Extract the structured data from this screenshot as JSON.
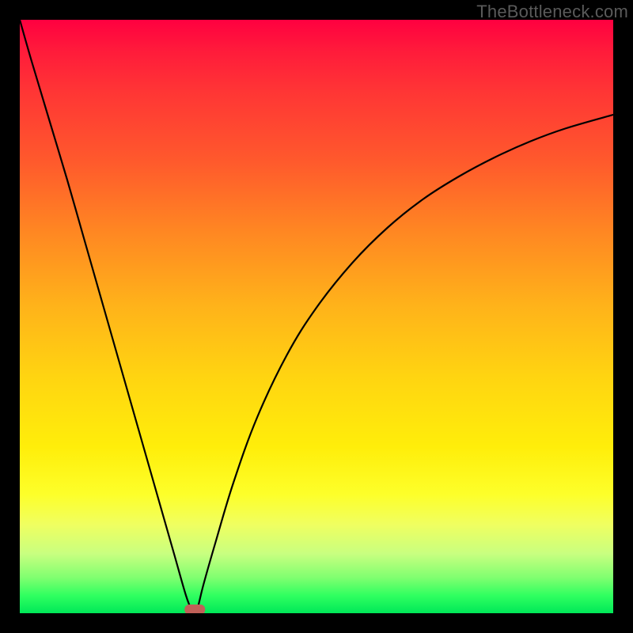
{
  "watermark": "TheBottleneck.com",
  "chart_data": {
    "type": "line",
    "title": "",
    "xlabel": "",
    "ylabel": "",
    "xlim": [
      0,
      100
    ],
    "ylim": [
      0,
      100
    ],
    "grid": false,
    "legend": false,
    "series": [
      {
        "name": "left-branch",
        "x": [
          0,
          2,
          5,
          8,
          11,
          14,
          17,
          20,
          23,
          26,
          28,
          29,
          29.5
        ],
        "y": [
          100,
          93,
          83,
          73,
          62.5,
          52,
          41.5,
          31,
          20.5,
          10,
          3,
          0.5,
          0
        ]
      },
      {
        "name": "right-branch",
        "x": [
          29.5,
          30,
          31,
          33,
          36,
          40,
          45,
          50,
          56,
          62,
          68,
          74,
          80,
          86,
          92,
          100
        ],
        "y": [
          0,
          1,
          5,
          12,
          22,
          33,
          43.5,
          51.5,
          59,
          65,
          69.8,
          73.6,
          76.8,
          79.5,
          81.7,
          84
        ]
      }
    ],
    "marker": {
      "name": "minimum-marker",
      "x": 29.5,
      "y": 0,
      "color": "#c06058",
      "shape": "rounded-rect"
    },
    "background_gradient": {
      "top": "#ff0040",
      "bottom": "#00e858"
    }
  }
}
